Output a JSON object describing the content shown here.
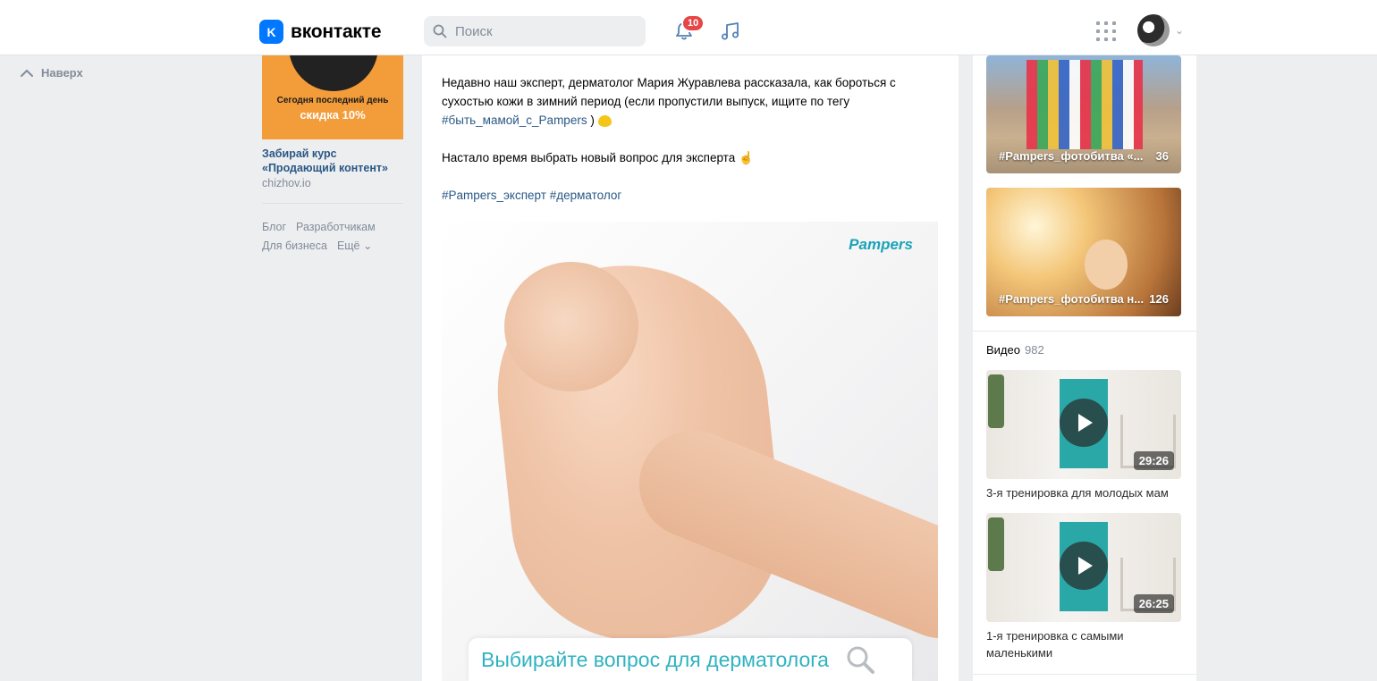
{
  "header": {
    "logo_mark": "K",
    "logo_text": "вконтакте",
    "search_placeholder": "Поиск",
    "notifications_count": "10",
    "avatar_caret": "⌄"
  },
  "left": {
    "up_label": "Наверх",
    "ad": {
      "banner_line1": "Сегодня последний день",
      "banner_line2": "скидка 10%",
      "title": "Забирай курс «Продающий контент»",
      "domain": "chizhov.io"
    },
    "footer_links": [
      "Блог",
      "Разработчикам",
      "Для бизнеса",
      "Ещё"
    ]
  },
  "post": {
    "paragraph1": "Недавно наш эксперт, дерматолог Мария Журавлева рассказала, как бороться с сухостью кожи в зимний период (если пропустили выпуск, ищите по тегу ",
    "paragraph1_tag": "#быть_мамой_с_Pampers",
    "paragraph1_end": " )",
    "paragraph2": "Настало время выбрать новый вопрос для эксперта",
    "tags": "#Pampers_эксперт #дерматолог",
    "image_brand": "Pampers",
    "image_caption": "Выбирайте вопрос для дерматолога"
  },
  "right": {
    "photos": [
      {
        "caption": "#Pampers_фотобитва «...",
        "count": "36"
      },
      {
        "caption": "#Pampers_фотобитва н...",
        "count": "126"
      }
    ],
    "videos_header": "Видео",
    "videos_count": "982",
    "videos": [
      {
        "duration": "29:26",
        "title": "3-я тренировка для молодых мам"
      },
      {
        "duration": "26:25",
        "title": "1-я тренировка с самыми маленькими"
      }
    ]
  },
  "colors": {
    "brand": "#0077ff",
    "link": "#2a5885",
    "badge": "#e64646",
    "background": "#edeef0"
  }
}
